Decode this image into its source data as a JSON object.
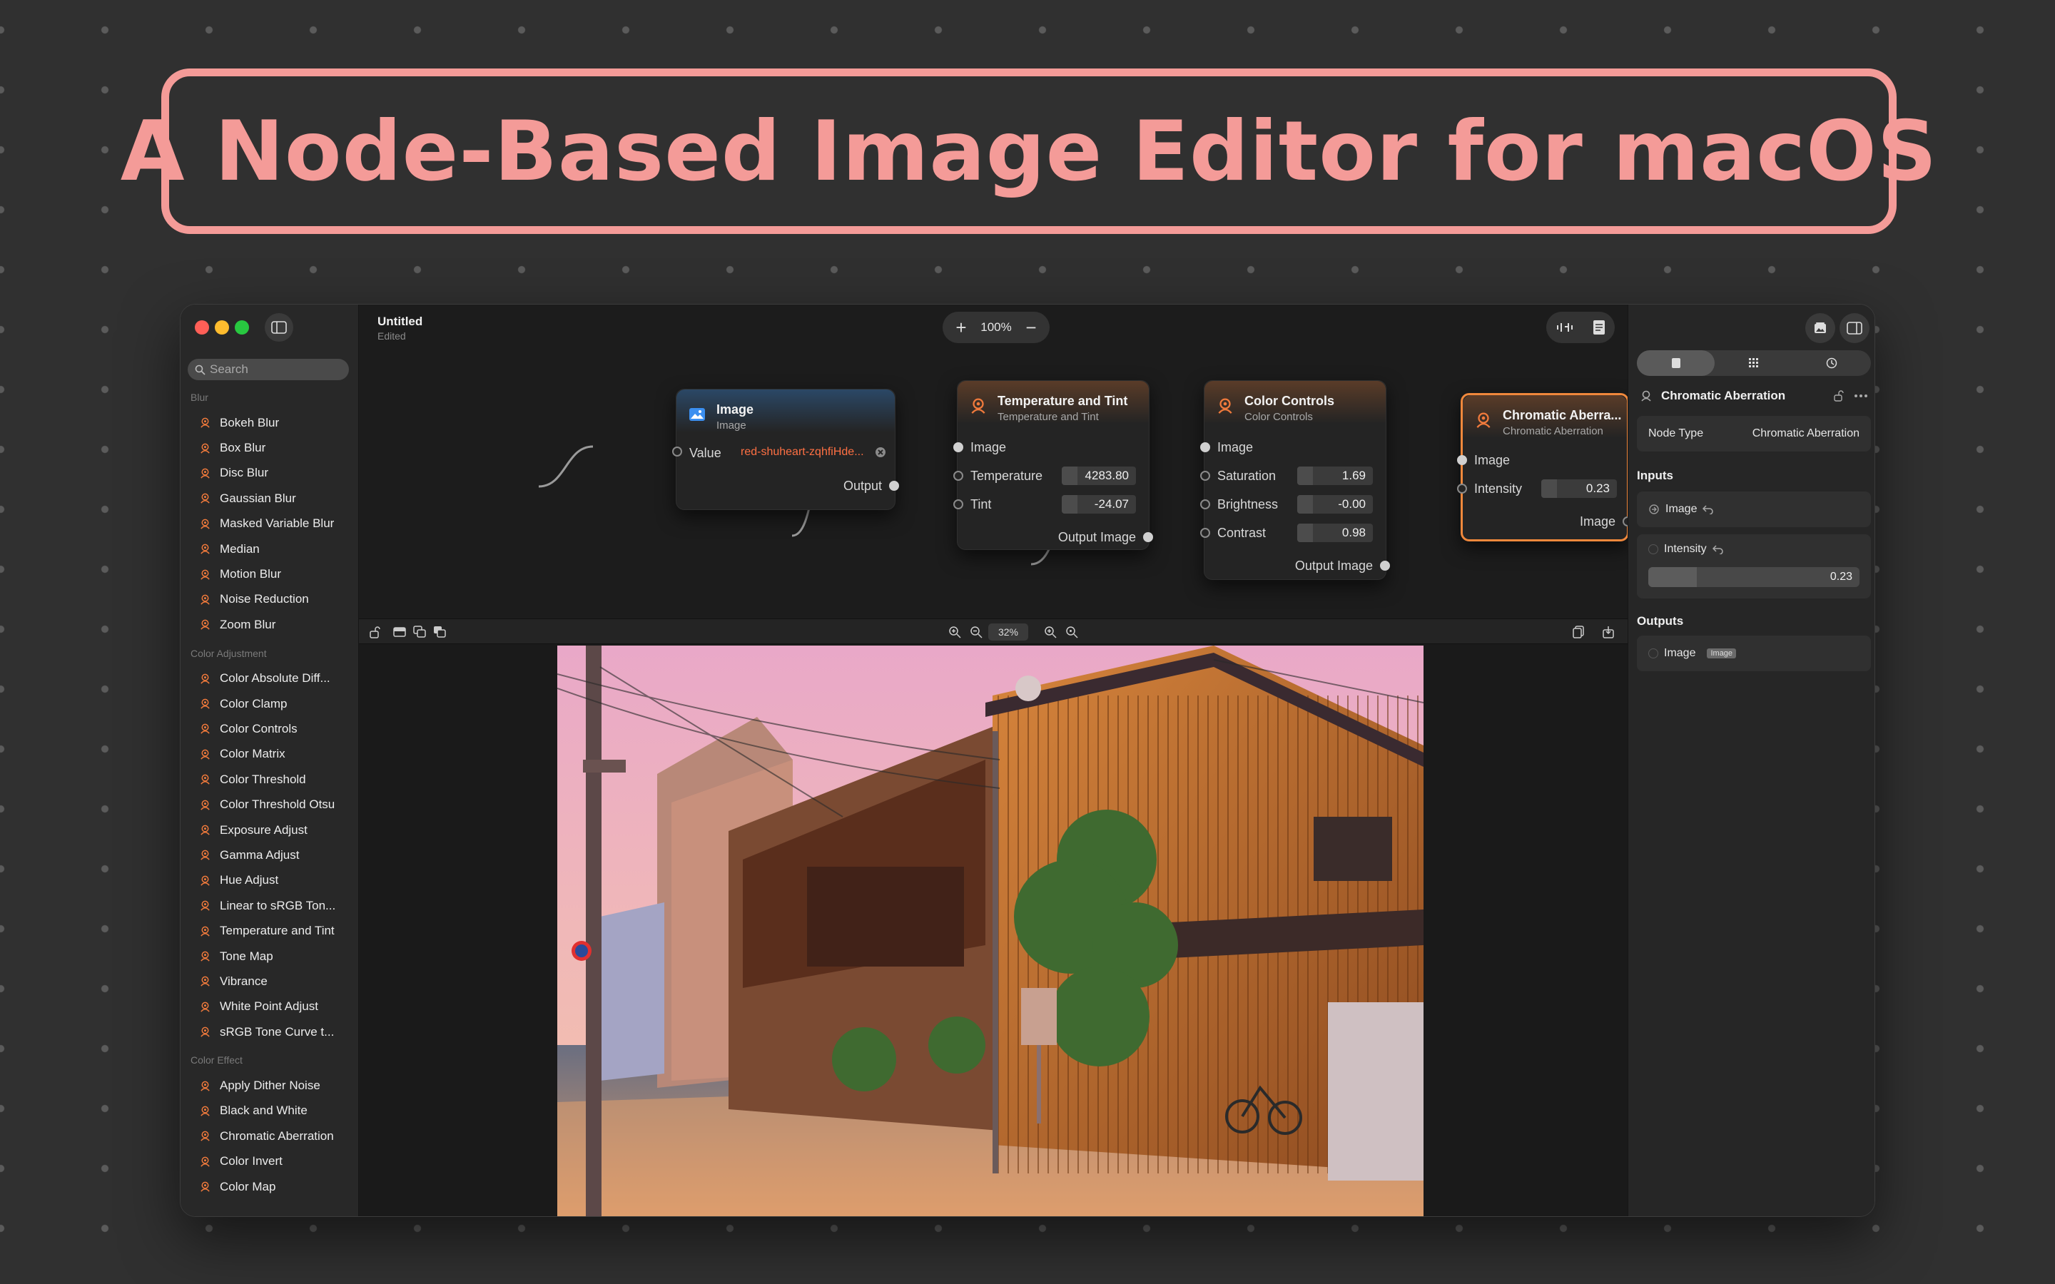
{
  "banner": {
    "title": "A Node-Based Image Editor for macOS"
  },
  "window": {
    "title": "Untitled",
    "status": "Edited",
    "zoom": "100%"
  },
  "sidebar": {
    "search_placeholder": "Search",
    "categories": [
      {
        "title": "Blur",
        "items": [
          "Bokeh Blur",
          "Box Blur",
          "Disc Blur",
          "Gaussian Blur",
          "Masked Variable Blur",
          "Median",
          "Motion Blur",
          "Noise Reduction",
          "Zoom Blur"
        ]
      },
      {
        "title": "Color Adjustment",
        "items": [
          "Color Absolute Diff...",
          "Color Clamp",
          "Color Controls",
          "Color Matrix",
          "Color Threshold",
          "Color Threshold Otsu",
          "Exposure Adjust",
          "Gamma Adjust",
          "Hue Adjust",
          "Linear to sRGB Ton...",
          "Temperature and Tint",
          "Tone Map",
          "Vibrance",
          "White Point Adjust",
          "sRGB Tone Curve t..."
        ]
      },
      {
        "title": "Color Effect",
        "items": [
          "Apply Dither Noise",
          "Black and White",
          "Chromatic Aberration",
          "Color Invert",
          "Color Map"
        ]
      }
    ]
  },
  "nodes": {
    "image": {
      "title": "Image",
      "subtitle": "Image",
      "value_label": "Value",
      "value": "red-shuheart-zqhfiHde...",
      "output_label": "Output"
    },
    "temp": {
      "title": "Temperature and Tint",
      "subtitle": "Temperature and Tint",
      "image_label": "Image",
      "temperature_label": "Temperature",
      "temperature": "4283.80",
      "tint_label": "Tint",
      "tint": "-24.07",
      "output_label": "Output Image"
    },
    "color": {
      "title": "Color Controls",
      "subtitle": "Color Controls",
      "image_label": "Image",
      "saturation_label": "Saturation",
      "saturation": "1.69",
      "brightness_label": "Brightness",
      "brightness": "-0.00",
      "contrast_label": "Contrast",
      "contrast": "0.98",
      "output_label": "Output Image"
    },
    "chroma": {
      "title": "Chromatic Aberra...",
      "subtitle": "Chromatic Aberration",
      "image_label": "Image",
      "intensity_label": "Intensity",
      "intensity": "0.23",
      "output_label": "Image"
    }
  },
  "viewer": {
    "zoom": "32%"
  },
  "inspector": {
    "node_name": "Chromatic Aberration",
    "node_type_label": "Node Type",
    "node_type_value": "Chromatic Aberration",
    "inputs_title": "Inputs",
    "input_image_label": "Image",
    "input_intensity_label": "Intensity",
    "intensity_value": "0.23",
    "intensity_fraction": 0.23,
    "outputs_title": "Outputs",
    "output_image_label": "Image",
    "output_tag": "Image"
  },
  "colors": {
    "accent": "#f49b98",
    "selected_node": "#f0883c",
    "link_value": "#ff7043"
  }
}
